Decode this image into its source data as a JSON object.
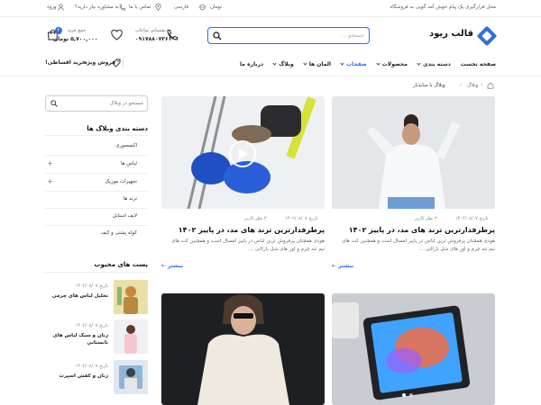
{
  "topbar": {
    "welcome": "محل قرارگیری یک پیام خوش آمد گویی به فروشگاه",
    "currency": "تومان",
    "language": "فارسی",
    "contact": "تماس با ما",
    "consult": "به مشاوره نیاز دارید؟",
    "login": "ورود"
  },
  "header": {
    "logo_text": "قالب ریود",
    "search_placeholder": "جستجو ...",
    "support_label": "پشتیبانی ساعات",
    "support_phone": "۰۹۱۷۸۸۰۷۳۶۱",
    "cart_label": "جمع خرید",
    "cart_total": "۵,۷۰۰,۰۰۰ تومان",
    "cart_count": "۲"
  },
  "nav": {
    "items": [
      {
        "label": "صفحه نخست",
        "dropdown": false
      },
      {
        "label": "دسته بندی",
        "dropdown": true
      },
      {
        "label": "محصولات",
        "dropdown": true
      },
      {
        "label": "صفحات",
        "dropdown": true
      },
      {
        "label": "المان ها",
        "dropdown": true
      },
      {
        "label": "وبلاگ",
        "dropdown": true
      },
      {
        "label": "درباره ما",
        "dropdown": false
      }
    ],
    "special_sale": "فروش ویژه",
    "installment": "خرید اقساطی!"
  },
  "breadcrumb": {
    "blog": "وبلاگ",
    "current": "وبلاگ با سایدبار"
  },
  "sidebar": {
    "search_placeholder": "جستجو در وبلاگ",
    "categories_title": "دسته بندی وبلاگ ها",
    "categories": [
      {
        "label": "اکسسوری",
        "expandable": false
      },
      {
        "label": "لباس ها",
        "expandable": true
      },
      {
        "label": "تجهیزات موزیک",
        "expandable": true
      },
      {
        "label": "ترند ها",
        "expandable": false
      },
      {
        "label": "لایف استایل",
        "expandable": false
      },
      {
        "label": "کوله پشتی و کیف",
        "expandable": false
      }
    ],
    "popular_title": "پست های محبوب",
    "popular": [
      {
        "date": "تاریخ ۱۴۰۲/۰۸/۰۷",
        "title": "تحلیل لباس های چرمی"
      },
      {
        "date": "تاریخ ۱۴۰۲/۰۸/۰۷",
        "title": "زنان و سبک لباس های تابستانی"
      },
      {
        "date": "تاریخ ۱۴۰۲/۰۸/۰۷",
        "title": "زنان و کفش اسپرت"
      }
    ]
  },
  "posts": [
    {
      "date": "تاریخ ۱۴۰۲/۰۸/۰۷",
      "comments": "۳ نظر کاربر",
      "title": "پرطرفدارترین ترند های مد، در پاییز ۱۴۰۲",
      "excerpt": "هودی همچنان پرفروش ترین لباس در پاییز امسال است و همچنین کت های نیم تنه چرم و اور های شل باراانی ...",
      "more": "بیشتر"
    },
    {
      "date": "تاریخ ۱۴۰۲/۰۸/۰۷",
      "comments": "۳ نظر کاربر",
      "title": "پرطرفدارترین ترند های مد، در پاییز ۱۴۰۲",
      "excerpt": "هودی همچنان پرفروش ترین لباس در پاییز امسال است و همچنین کت های نیم تنه چرم و اور های شل باراانی ...",
      "more": "بیشتر"
    }
  ],
  "colors": {
    "accent": "#2f6fde"
  },
  "icons": [
    "user-icon",
    "location-icon",
    "phone-icon",
    "heart-icon",
    "cart-icon",
    "search-icon",
    "home-icon",
    "tag-icon",
    "play-icon",
    "arrow-left-icon",
    "globe-icon"
  ]
}
